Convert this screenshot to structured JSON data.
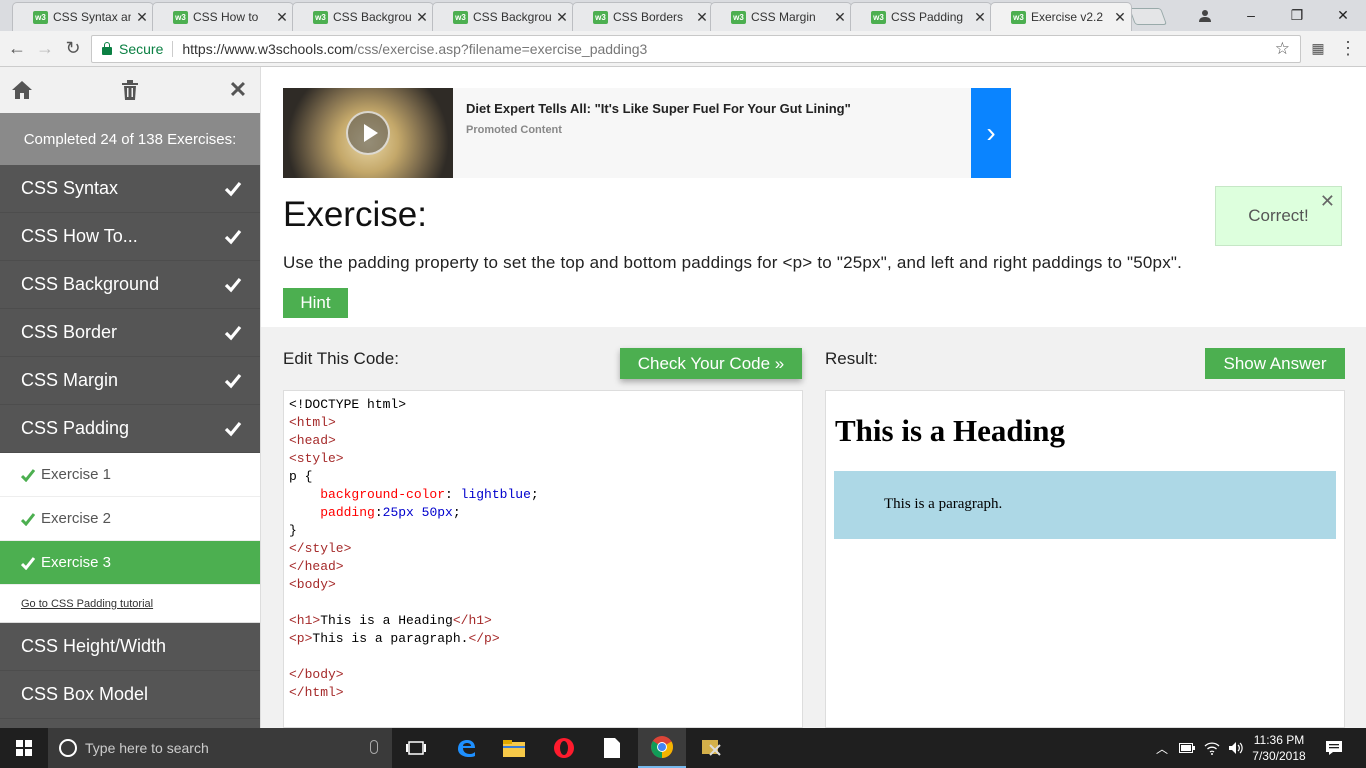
{
  "browser": {
    "tabs": [
      {
        "title": "CSS Syntax and",
        "active": false
      },
      {
        "title": "CSS How to",
        "active": false
      },
      {
        "title": "CSS Backgroun",
        "active": false
      },
      {
        "title": "CSS Backgroun",
        "active": false
      },
      {
        "title": "CSS Borders",
        "active": false
      },
      {
        "title": "CSS Margin",
        "active": false
      },
      {
        "title": "CSS Padding",
        "active": false
      },
      {
        "title": "Exercise v2.2",
        "active": true
      }
    ],
    "secure_label": "Secure",
    "url_host": "https://www.w3schools.com",
    "url_path": "/css/exercise.asp?filename=exercise_padding3"
  },
  "sidebar": {
    "completed_text": "Completed 24 of 138 Exercises:",
    "sections": [
      {
        "label": "CSS Syntax",
        "done": true
      },
      {
        "label": "CSS How To...",
        "done": true
      },
      {
        "label": "CSS Background",
        "done": true
      },
      {
        "label": "CSS Border",
        "done": true
      },
      {
        "label": "CSS Margin",
        "done": true
      },
      {
        "label": "CSS Padding",
        "done": true
      }
    ],
    "exercises": [
      {
        "label": "Exercise 1",
        "active": false
      },
      {
        "label": "Exercise 2",
        "active": false
      },
      {
        "label": "Exercise 3",
        "active": true
      }
    ],
    "tutorial_link": "Go to CSS Padding tutorial",
    "more_sections": [
      {
        "label": "CSS Height/Width"
      },
      {
        "label": "CSS Box Model"
      }
    ]
  },
  "ad": {
    "title": "Diet Expert Tells All: \"It's Like Super Fuel For Your Gut Lining\"",
    "subtitle": "Promoted Content"
  },
  "exercise": {
    "title": "Exercise:",
    "correct_label": "Correct!",
    "instruction": "Use the padding property to set the top and bottom paddings for <p> to \"25px\", and left and right paddings to \"50px\".",
    "hint_label": "Hint",
    "edit_label": "Edit This Code:",
    "check_label": "Check Your Code »",
    "result_label": "Result:",
    "show_answer_label": "Show Answer"
  },
  "code_lines": [
    "<!DOCTYPE html>",
    "<html>",
    "<head>",
    "<style>",
    "p {",
    "    background-color: lightblue;",
    "    padding:25px 50px;",
    "}",
    "</style>",
    "</head>",
    "<body>",
    "",
    "<h1>This is a Heading</h1>",
    "<p>This is a paragraph.</p>",
    "",
    "</body>",
    "</html>"
  ],
  "result": {
    "heading": "This is a Heading",
    "paragraph": "This is a paragraph."
  },
  "taskbar": {
    "search_placeholder": "Type here to search",
    "time": "11:36 PM",
    "date": "7/30/2018"
  },
  "colors": {
    "accent_green": "#4caf50",
    "sidebar_bg": "#555555",
    "result_paragraph_bg": "#add8e6",
    "ad_button": "#0a84ff"
  }
}
